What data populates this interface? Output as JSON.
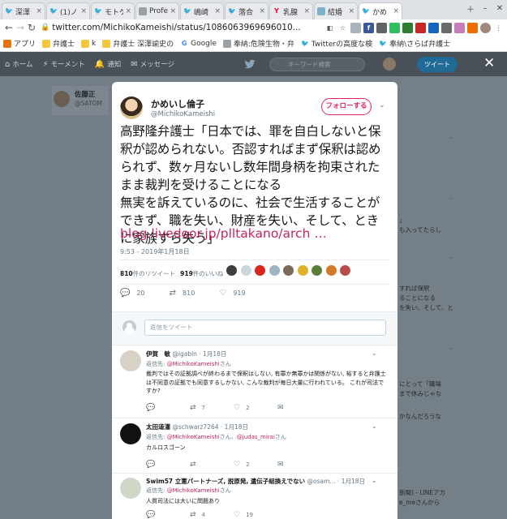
{
  "browser": {
    "tabs": [
      {
        "label": "深澤",
        "icon": "twitter-icon",
        "active": false
      },
      {
        "label": "(1)ノ",
        "icon": "twitter-icon",
        "active": false
      },
      {
        "label": "モトケ",
        "icon": "twitter-icon",
        "active": false
      },
      {
        "label": "Profe",
        "icon": "page-icon",
        "active": false
      },
      {
        "label": "嶋崎",
        "icon": "twitter-icon",
        "active": false
      },
      {
        "label": "落合",
        "icon": "twitter-icon",
        "active": false
      },
      {
        "label": "乳腺",
        "icon": "yahoo-icon",
        "active": false
      },
      {
        "label": "結婚",
        "icon": "image-icon",
        "active": false
      },
      {
        "label": "かめ",
        "icon": "twitter-icon",
        "active": true
      }
    ],
    "url": "twitter.com/MichikoKameishi/status/1086063969696010...",
    "bookmarks": [
      {
        "label": "アプリ",
        "icon": "apps-icon"
      },
      {
        "label": "弁護士",
        "icon": "folder-icon"
      },
      {
        "label": "k",
        "icon": "folder-icon"
      },
      {
        "label": "弁護士 深澤諭史の",
        "icon": "folder-icon"
      },
      {
        "label": "Google",
        "icon": "google-icon"
      },
      {
        "label": "奉納:危険生物・弁",
        "icon": "page-icon"
      },
      {
        "label": "Twitterの高度な検",
        "icon": "twitter-icon"
      },
      {
        "label": "奉納\\さらば弁護士",
        "icon": "twitter-icon"
      }
    ]
  },
  "twitter_nav": {
    "home": "ホーム",
    "moments": "モーメント",
    "notifications": "通知",
    "messages": "メッセージ",
    "search_placeholder": "キーワード検索",
    "tweet_button": "ツイート"
  },
  "background": {
    "profile_name": "佐藤正",
    "profile_handle": "@SATOM",
    "side_snippets": [
      "」",
      "も入ってたらし",
      "すれば保釈",
      "ることになる",
      "を失い、そして、と",
      "にとって「職場",
      "まで休みじゃな",
      "かなんだろうな",
      "新聞) - LINEアカ",
      "e_meさんから"
    ]
  },
  "tweet": {
    "display_name": "かめいし倫子",
    "username": "@MichikoKameishi",
    "follow_label": "フォローする",
    "text": "高野隆弁護士「日本では、罪を自白しないと保釈が認められない。否認すればまず保釈は認められず、数ヶ月ないし数年間身柄を拘束されたまま裁判を受けることになる\n無実を訴えているのに、社会で生活することができず、職を失い、財産を失い、そして、ときに家族すら失う」",
    "link": "blog.livedoor.jp/plltakano/arch …",
    "timestamp": "9:53 - 2019年1月18日",
    "retweets_count": "810",
    "retweets_label": "件のリツイート",
    "likes_count": "919",
    "likes_label": "件のいいね",
    "reply_count": "20",
    "retweet_count_short": "810",
    "like_count_short": "919",
    "reply_placeholder": "返信をツイート"
  },
  "replies": [
    {
      "name": "伊賀　敏",
      "handle": "@igabin",
      "date": "1月18日",
      "reply_to_prefix": "返信先: ",
      "reply_to": "@MichikoKameishi",
      "reply_to_suffix": "さん",
      "text": "裁判ではその証拠調べが終わるまで保釈はしない, 有罪か無罪かは関係がない, 裕すると弁護士は不同意の証拠でも同意するしかない, こんな裁判が毎日大量に行われている。 これが司法ですか?",
      "retweets": "7",
      "likes": "2"
    },
    {
      "name": "太田道灌",
      "handle": "@schwarz7264",
      "date": "1月18日",
      "reply_to_prefix": "返信先: ",
      "reply_to": "@MichikoKameishi",
      "reply_to_mid": "さん、",
      "reply_to_2": "@judas_mirai",
      "reply_to_suffix": "さん",
      "text": "カルロスゴーン",
      "retweets": "",
      "likes": "2"
    },
    {
      "name": "Swim57 立憲パートナーズ, 脱原発, 遺伝子組換えでない",
      "handle": "@osam...",
      "date": "1月18日",
      "reply_to_prefix": "返信先: ",
      "reply_to": "@MichikoKameishi",
      "reply_to_suffix": "さん",
      "text": "人質司法には大いに問題あり",
      "retweets": "4",
      "likes": "19"
    }
  ],
  "colors": {
    "accent": "#e0245e",
    "link": "#c8235a",
    "twitter_blue": "#1da1f2"
  }
}
